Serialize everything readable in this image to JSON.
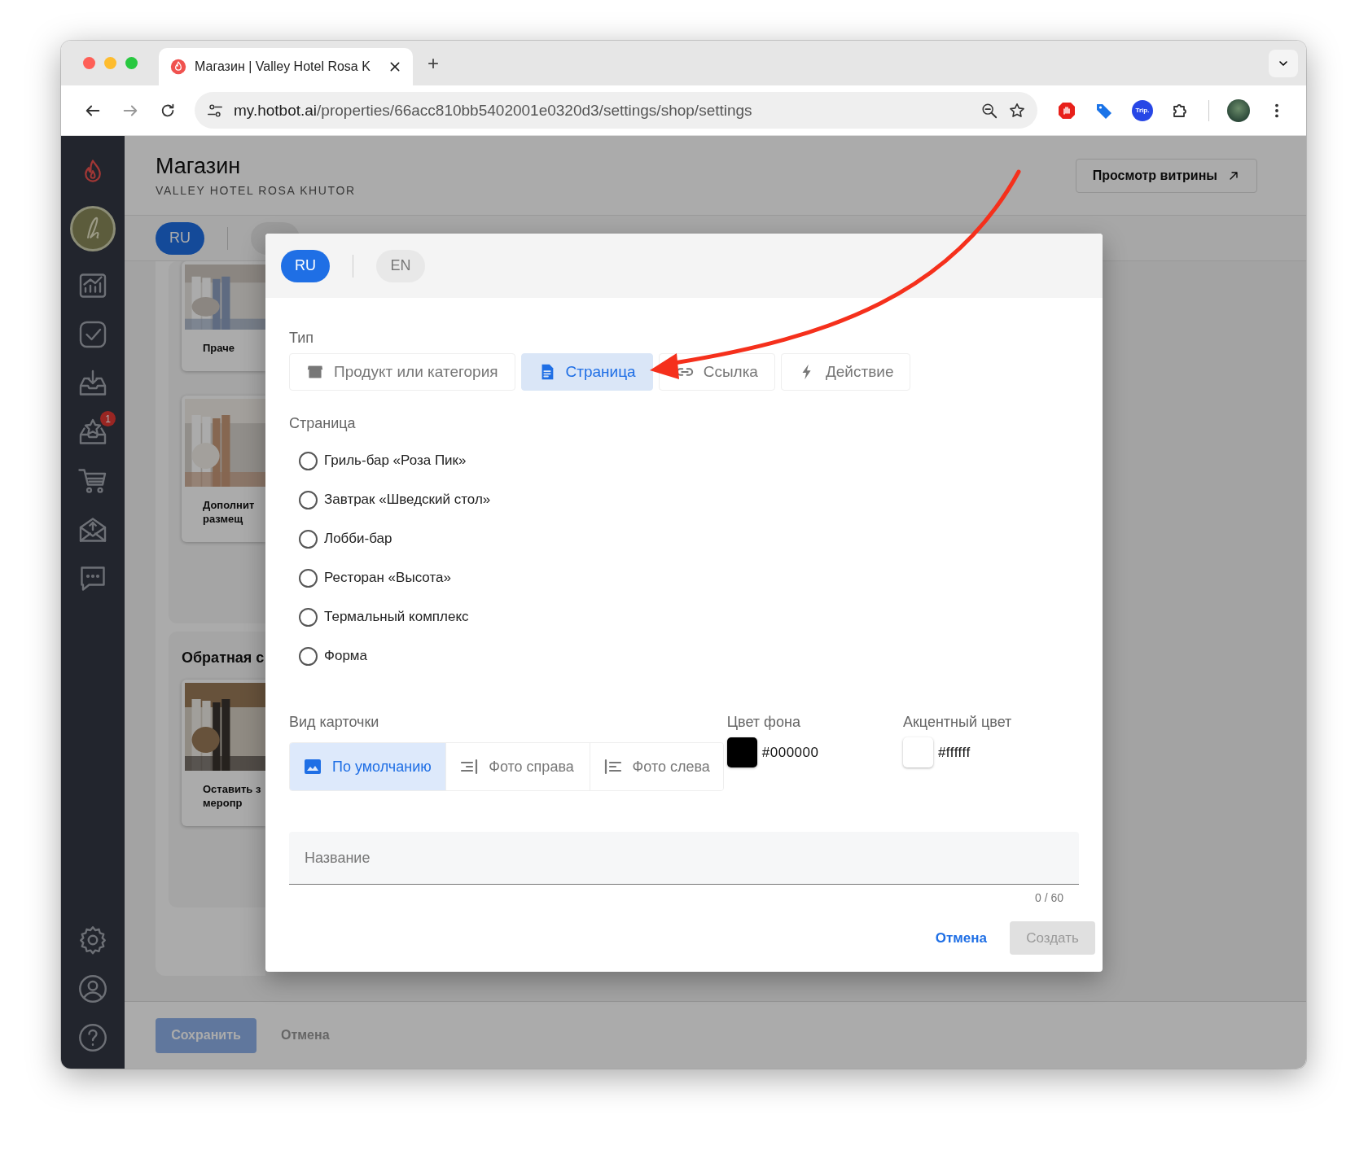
{
  "browser": {
    "tab_title": "Магазин | Valley Hotel Rosa K",
    "new_tab": "+",
    "url_host": "my.hotbot.ai",
    "url_path": "/properties/66acc810bb5402001e0320d3/settings/shop/settings",
    "trip_extension_label": "Trip."
  },
  "sidebar": {
    "items": [
      {
        "kind": "chart"
      },
      {
        "kind": "check"
      },
      {
        "kind": "inbox"
      },
      {
        "kind": "star-inbox",
        "badge": "1"
      },
      {
        "kind": "cart"
      },
      {
        "kind": "mail"
      },
      {
        "kind": "chat"
      }
    ],
    "bottom_items": [
      {
        "kind": "gear"
      },
      {
        "kind": "user"
      },
      {
        "kind": "help"
      }
    ]
  },
  "page": {
    "title": "Магазин",
    "subtitle": "VALLEY HOTEL ROSA KHUTOR",
    "storefront_button": "Просмотр витрины",
    "languages": [
      {
        "label": "RU",
        "selected": true
      }
    ],
    "sections": [
      {
        "cards": [
          {
            "lines": [
              "Праче"
            ]
          },
          {
            "lines": [
              "Дополнит",
              "размещ"
            ]
          }
        ]
      },
      {
        "title": "Обратная с",
        "cards": [
          {
            "lines": [
              "Оставить з",
              "меропр"
            ]
          }
        ]
      }
    ],
    "save_button": {
      "label": "Сохранить",
      "disabled": true
    },
    "cancel_button": "Отмена"
  },
  "dialog": {
    "languages": [
      {
        "label": "RU",
        "selected": true
      },
      {
        "label": "EN",
        "selected": false
      }
    ],
    "type_label": "Тип",
    "types": [
      {
        "kind": "product",
        "label": "Продукт или категория",
        "selected": false
      },
      {
        "kind": "page",
        "label": "Страница",
        "selected": true
      },
      {
        "kind": "link",
        "label": "Ссылка",
        "selected": false
      },
      {
        "kind": "action",
        "label": "Действие",
        "selected": false
      }
    ],
    "page_label": "Страница",
    "pages": [
      {
        "label": "Гриль-бар «Роза Пик»",
        "selected": false
      },
      {
        "label": "Завтрак «Шведский стол»",
        "selected": false
      },
      {
        "label": "Лобби-бар",
        "selected": false
      },
      {
        "label": "Ресторан «Высота»",
        "selected": false
      },
      {
        "label": "Термальный комплекс",
        "selected": false
      },
      {
        "label": "Форма",
        "selected": false
      }
    ],
    "card_view_label": "Вид карточки",
    "card_views": [
      {
        "kind": "default",
        "label": "По умолчанию",
        "selected": true
      },
      {
        "kind": "photo-right",
        "label": "Фото справа",
        "selected": false
      },
      {
        "kind": "photo-left",
        "label": "Фото слева",
        "selected": false
      }
    ],
    "colors": [
      {
        "label": "Цвет фона",
        "value": "#000000"
      },
      {
        "label": "Акцентный цвет",
        "value": "#ffffff"
      }
    ],
    "name_field": {
      "placeholder": "Название",
      "counter": "0 / 60"
    },
    "cancel_button": "Отмена",
    "create_button": {
      "label": "Создать",
      "disabled": true
    }
  }
}
